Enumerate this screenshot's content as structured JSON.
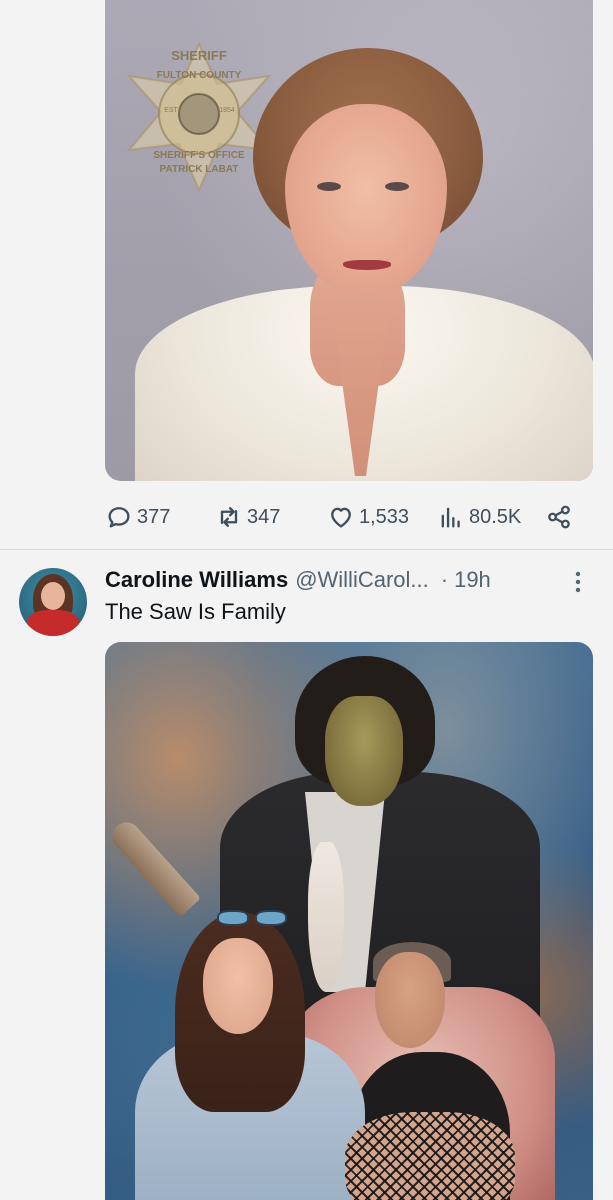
{
  "tweet_1": {
    "media": {
      "badge_text": [
        "SHERIFF",
        "FULTON COUNTY",
        "EST",
        "1854",
        "SHERIFF'S OFFICE",
        "PATRICK LABAT"
      ]
    },
    "actions": {
      "replies": "377",
      "retweets": "347",
      "likes": "1,533",
      "views": "80.5K"
    }
  },
  "tweet_2": {
    "author": {
      "display_name": "Caroline Williams",
      "handle": "@WilliCarol...",
      "separator": "·",
      "time": "19h"
    },
    "text": "The Saw Is Family"
  },
  "icons": {
    "reply": "speech-bubble-icon",
    "retweet": "retweet-icon",
    "like": "heart-icon",
    "views": "bar-chart-icon",
    "share": "share-icon",
    "more": "more-vertical-icon"
  },
  "colors": {
    "background": "#f3f3f3",
    "text_primary": "#0f1419",
    "text_secondary": "#536471",
    "icon": "#3f4e5c"
  }
}
